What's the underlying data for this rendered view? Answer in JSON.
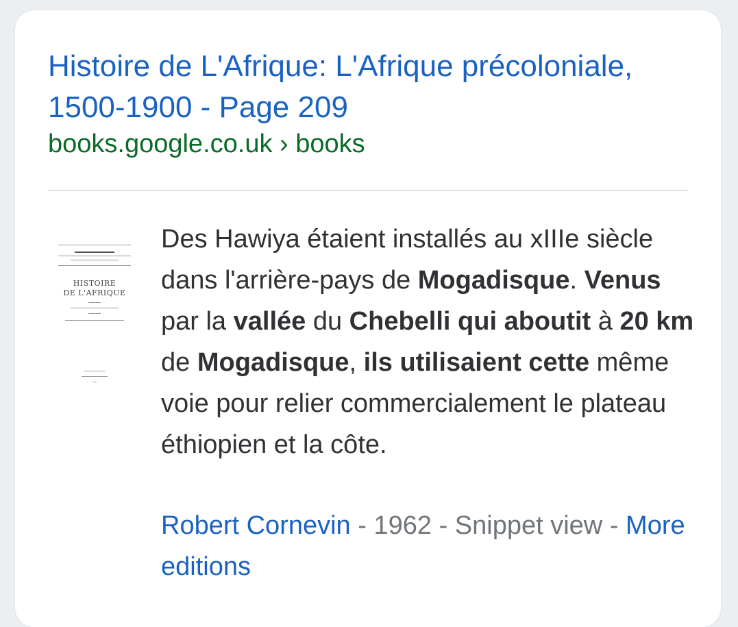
{
  "result": {
    "title": "Histoire de L'Afrique: L'Afrique précoloniale, 1500-1900 - Page 209",
    "url": "books.google.co.uk › books"
  },
  "thumbnail": {
    "line1": "HISTOIRE",
    "line2": "DE L'AFRIQUE"
  },
  "snippet": {
    "p1": "Des Hawiya étaient installés au xIIIe siècle dans l'arrière-pays de ",
    "b1": "Mogadisque",
    "p2": ". ",
    "b2": "Venus",
    "p3": " par la ",
    "b3": "vallée",
    "p4": " du ",
    "b4": "Chebelli qui aboutit",
    "p5": " à ",
    "b5": "20 km",
    "p6": " de ",
    "b6": "Mogadisque",
    "p7": ", ",
    "b7": "ils utilisaient cette",
    "p8": " même voie pour relier commercialement le plateau éthiopien et la côte."
  },
  "meta": {
    "author": "Robert Cornevin",
    "sep1": " - ",
    "year": "1962",
    "sep2": " - ",
    "view": "Snippet view",
    "sep3": " - ",
    "more": "More editions"
  },
  "colors": {
    "link": "#1a62c2",
    "url": "#0b6a26",
    "text": "#303134",
    "meta": "#70757a"
  }
}
